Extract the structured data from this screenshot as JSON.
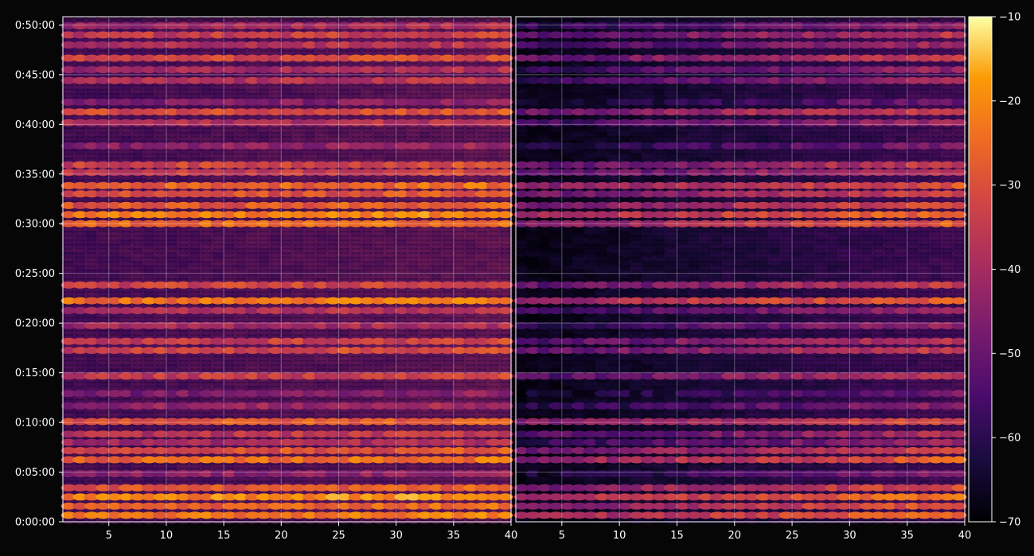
{
  "chart_data": {
    "type": "heatmap",
    "title": "",
    "xlabel": "",
    "ylabel": "",
    "panels": [
      {
        "name": "left",
        "xlim": [
          1,
          40
        ],
        "xticks": [
          5,
          10,
          15,
          20,
          25,
          30,
          35,
          40
        ],
        "xtick_labels": [
          "5",
          "10",
          "15",
          "20",
          "25",
          "30",
          "35",
          "40"
        ],
        "base_level": -48,
        "left_fade": false
      },
      {
        "name": "right",
        "xlim": [
          1,
          40
        ],
        "xticks": [
          5,
          10,
          15,
          20,
          25,
          30,
          35,
          40
        ],
        "xtick_labels": [
          "5",
          "10",
          "15",
          "20",
          "25",
          "30",
          "35",
          "40"
        ],
        "base_level": -54,
        "left_fade": true
      }
    ],
    "y_axis": {
      "unit": "seconds",
      "ylim": [
        0,
        3050
      ],
      "ticks": [
        0,
        300,
        600,
        900,
        1200,
        1500,
        1800,
        2100,
        2400,
        2700,
        3000
      ],
      "tick_labels": [
        "0:00:00",
        "0:05:00",
        "0:10:00",
        "0:15:00",
        "0:20:00",
        "0:25:00",
        "0:30:00",
        "0:35:00",
        "0:40:00",
        "0:45:00",
        "0:50:00"
      ]
    },
    "colorbar": {
      "colormap": "inferno",
      "range": [
        -70,
        -10
      ],
      "ticks": [
        -10,
        -20,
        -30,
        -40,
        -50,
        -60,
        -70
      ],
      "tick_labels": [
        "−10",
        "−20",
        "−30",
        "−40",
        "−50",
        "−60",
        "−70"
      ]
    },
    "bands": [
      {
        "t": 40,
        "level": -25
      },
      {
        "t": 95,
        "level": -28
      },
      {
        "t": 150,
        "level": -22
      },
      {
        "t": 205,
        "level": -30
      },
      {
        "t": 290,
        "level": -46
      },
      {
        "t": 375,
        "level": -27
      },
      {
        "t": 430,
        "level": -32
      },
      {
        "t": 480,
        "level": -42
      },
      {
        "t": 530,
        "level": -38
      },
      {
        "t": 605,
        "level": -30
      },
      {
        "t": 700,
        "level": -44
      },
      {
        "t": 775,
        "level": -48
      },
      {
        "t": 880,
        "level": -36
      },
      {
        "t": 1035,
        "level": -34
      },
      {
        "t": 1090,
        "level": -36
      },
      {
        "t": 1185,
        "level": -42
      },
      {
        "t": 1275,
        "level": -40
      },
      {
        "t": 1335,
        "level": -25
      },
      {
        "t": 1430,
        "level": -34
      },
      {
        "t": 1800,
        "level": -27
      },
      {
        "t": 1855,
        "level": -24
      },
      {
        "t": 1910,
        "level": -30
      },
      {
        "t": 1980,
        "level": -32
      },
      {
        "t": 2030,
        "level": -28
      },
      {
        "t": 2110,
        "level": -36
      },
      {
        "t": 2155,
        "level": -34
      },
      {
        "t": 2270,
        "level": -46
      },
      {
        "t": 2410,
        "level": -40
      },
      {
        "t": 2475,
        "level": -32
      },
      {
        "t": 2535,
        "level": -48
      },
      {
        "t": 2665,
        "level": -40
      },
      {
        "t": 2730,
        "level": -42
      },
      {
        "t": 2800,
        "level": -34
      },
      {
        "t": 2880,
        "level": -40
      },
      {
        "t": 2940,
        "level": -36
      },
      {
        "t": 2995,
        "level": -42
      }
    ]
  }
}
